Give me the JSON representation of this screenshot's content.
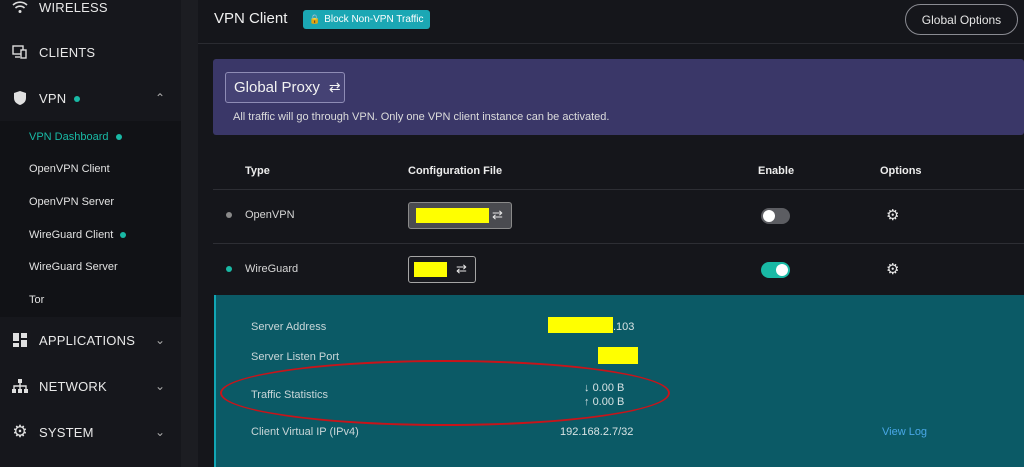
{
  "sidebar": {
    "items": [
      {
        "label": "WIRELESS",
        "icon": "wifi-icon"
      },
      {
        "label": "CLIENTS",
        "icon": "clients-icon"
      },
      {
        "label": "VPN",
        "icon": "shield-icon"
      },
      {
        "label": "APPLICATIONS",
        "icon": "apps-icon"
      },
      {
        "label": "NETWORK",
        "icon": "network-icon"
      },
      {
        "label": "SYSTEM",
        "icon": "gear-icon"
      }
    ],
    "vpn_submenu": [
      {
        "label": "VPN Dashboard",
        "active": true,
        "dot": true
      },
      {
        "label": "OpenVPN Client"
      },
      {
        "label": "OpenVPN Server"
      },
      {
        "label": "WireGuard Client",
        "dot": true
      },
      {
        "label": "WireGuard Server"
      },
      {
        "label": "Tor"
      }
    ]
  },
  "header": {
    "title": "VPN Client",
    "block_badge": "Block Non-VPN Traffic",
    "global_options": "Global Options"
  },
  "proxy": {
    "mode_label": "Global Proxy",
    "description": "All traffic will go through VPN. Only one VPN client instance can be activated."
  },
  "table": {
    "headers": {
      "type": "Type",
      "config": "Configuration File",
      "enable": "Enable",
      "options": "Options"
    },
    "rows": [
      {
        "type": "OpenVPN",
        "enabled": false,
        "status_color": "#8a8a8a"
      },
      {
        "type": "WireGuard",
        "enabled": true,
        "status_color": "#19b9a5"
      }
    ]
  },
  "details": {
    "server_address_label": "Server Address",
    "server_address_suffix": ".103",
    "listen_port_label": "Server Listen Port",
    "traffic_label": "Traffic Statistics",
    "traffic_down": "0.00 B",
    "traffic_up": "0.00 B",
    "client_ip_label": "Client Virtual IP (IPv4)",
    "client_ip_value": "192.168.2.7/32",
    "view_log": "View Log"
  },
  "colors": {
    "accent": "#19b9a5",
    "panel": "#3a3768",
    "detail_bg": "#0b5a66",
    "annotation": "#c8141a",
    "redaction": "#ffff00"
  }
}
